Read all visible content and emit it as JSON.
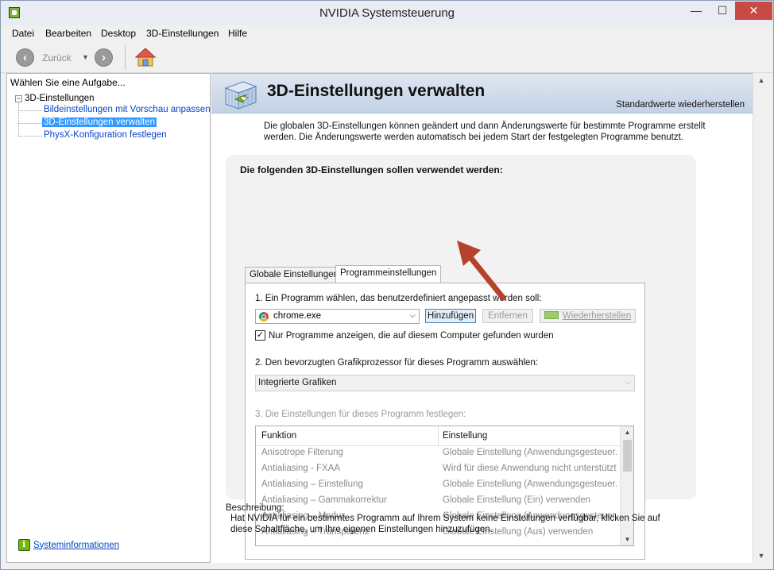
{
  "window": {
    "title": "NVIDIA Systemsteuerung",
    "controls": {
      "minimize": "—",
      "maximize": "☐",
      "close": "✕"
    }
  },
  "menu": [
    "Datei",
    "Bearbeiten",
    "Desktop",
    "3D-Einstellungen",
    "Hilfe"
  ],
  "toolbar": {
    "back_label": "Zurück",
    "back_icon": "back-arrow-icon",
    "forward_icon": "forward-arrow-icon",
    "home_icon": "home-icon"
  },
  "left_pane": {
    "header": "Wählen Sie eine Aufgabe...",
    "tree_root": "3D-Einstellungen",
    "tree_toggle": "−",
    "items": [
      {
        "label": "Bildeinstellungen mit Vorschau anpassen",
        "selected": false
      },
      {
        "label": "3D-Einstellungen verwalten",
        "selected": true
      },
      {
        "label": "PhysX-Konfiguration festlegen",
        "selected": false
      }
    ],
    "system_info": "Systeminformationen"
  },
  "page": {
    "title": "3D-Einstellungen verwalten",
    "restore_defaults": "Standardwerte wiederherstellen",
    "intro": "Die globalen 3D-Einstellungen können geändert und dann Änderungswerte für bestimmte Programme erstellt werden. Die Änderungswerte werden automatisch bei jedem Start der festgelegten Programme benutzt.",
    "panel_heading": "Die folgenden 3D-Einstellungen sollen verwendet werden:",
    "tabs": [
      {
        "label": "Globale Einstellungen",
        "active": false
      },
      {
        "label": "Programmeinstellungen",
        "active": true
      }
    ],
    "step1_label": "1. Ein Programm wählen, das benutzerdefiniert angepasst werden soll:",
    "program_selected": "chrome.exe",
    "buttons": {
      "add": "Hinzufügen",
      "remove": "Entfernen",
      "restore": "Wiederherstellen"
    },
    "checkbox_checked": true,
    "checkbox_mark": "✓",
    "checkbox_label": "Nur Programme anzeigen, die auf diesem Computer gefunden wurden",
    "step2_label": "2. Den bevorzugten Grafikprozessor für dieses Programm auswählen:",
    "gpu_selected": "Integrierte Grafiken",
    "step3_label": "3. Die Einstellungen für dieses Programm festlegen:",
    "grid_headers": [
      "Funktion",
      "Einstellung"
    ],
    "grid_rows": [
      [
        "Anisotrope Filterung",
        "Globale Einstellung (Anwendungsgesteuer..."
      ],
      [
        "Antialiasing - FXAA",
        "Wird für diese Anwendung nicht unterstützt"
      ],
      [
        "Antialiasing – Einstellung",
        "Globale Einstellung (Anwendungsgesteuer..."
      ],
      [
        "Antialiasing – Gammakorrektur",
        "Globale Einstellung (Ein) verwenden"
      ],
      [
        "Antialiasing – Modus",
        "Globale Einstellung (Anwendungsgesteuer..."
      ],
      [
        "Antialiasing – Transparenz",
        "Globale Einstellung (Aus) verwenden"
      ]
    ],
    "description_label": "Beschreibung:",
    "description": "Hat NVIDIA für ein bestimmtes Programm auf Ihrem System keine Einstellungen verfügbar, klicken Sie auf diese Schaltfläche, um Ihre eigenen Einstellungen hinzuzufügen."
  },
  "colors": {
    "accent_arrow": "#b5422a",
    "selection": "#3399ff",
    "link": "#0645c8",
    "close_button": "#c74a44",
    "nvidia_green": "#76b900"
  }
}
